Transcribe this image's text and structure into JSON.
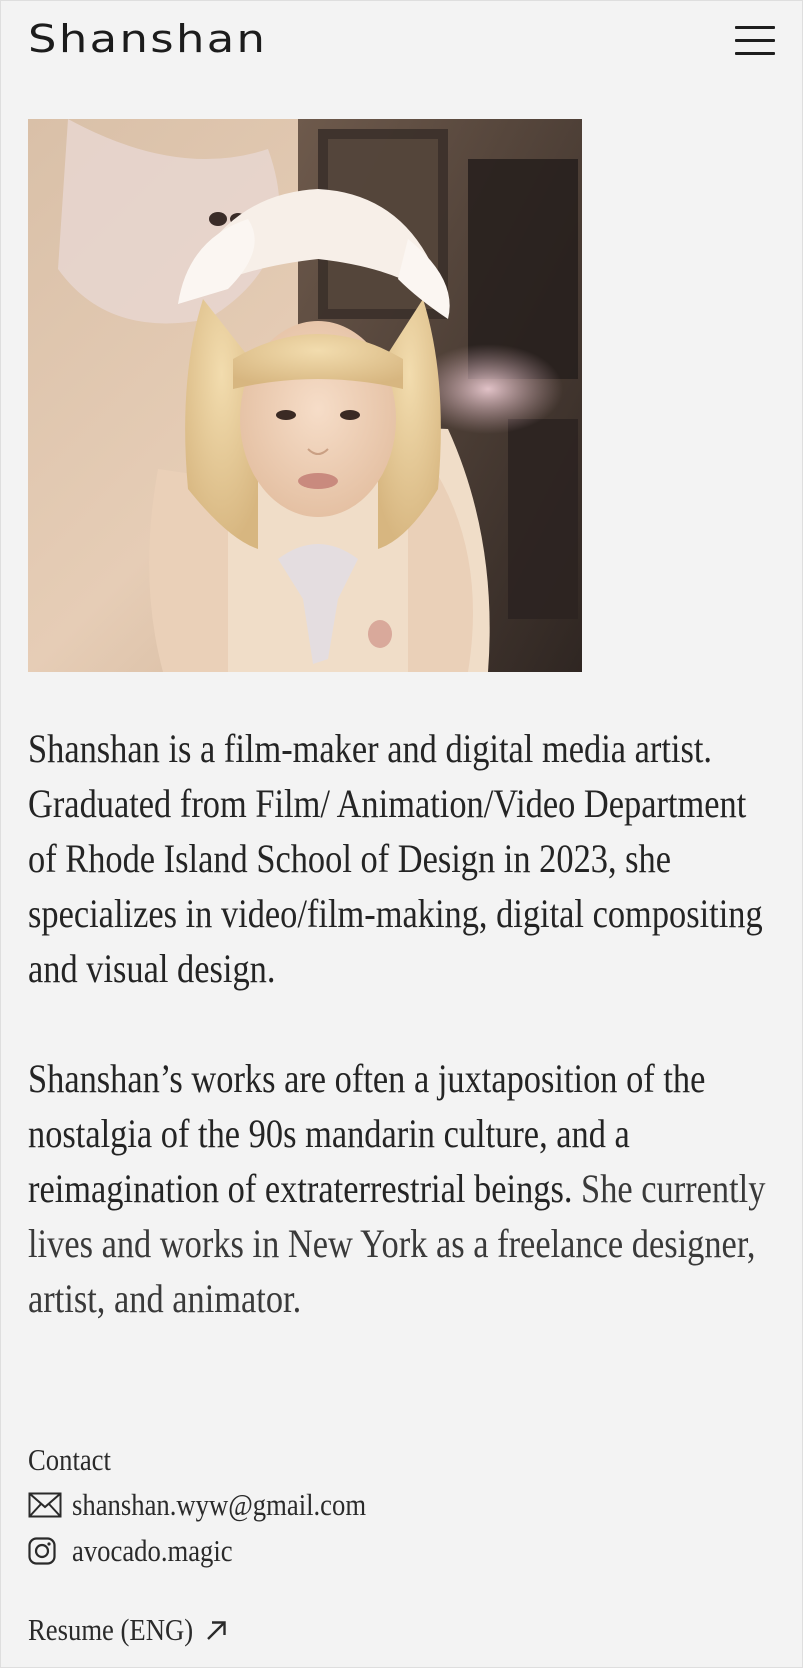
{
  "header": {
    "site_title": "Shanshan",
    "menu_icon": "hamburger-menu-icon"
  },
  "portrait": {
    "alt": "Portrait photo"
  },
  "bio": {
    "paragraph_1": "Shanshan is a film-maker and digital media artist. Graduated from Film/ Animation/Video Department of Rhode Island School of Design in 2023, she specializes in video/film-making, digital compositing and visual design.",
    "paragraph_2_main": "Shanshan’s works are often a juxtaposition of the nostalgia of the 90s mandarin culture, and a reimagination of extraterrestrial beings.",
    "paragraph_2_rest": " She currently lives and works in New York as a freelance designer, artist, and animator."
  },
  "contact": {
    "heading": "Contact",
    "email": {
      "icon": "mail-icon",
      "value": "shanshan.wyw@gmail.com"
    },
    "instagram": {
      "icon": "instagram-icon",
      "value": "avocado.magic"
    }
  },
  "resume": {
    "label": "Resume (ENG)",
    "icon": "arrow-up-right-icon"
  },
  "colors": {
    "background": "#f3f3f3",
    "text": "#242424"
  }
}
